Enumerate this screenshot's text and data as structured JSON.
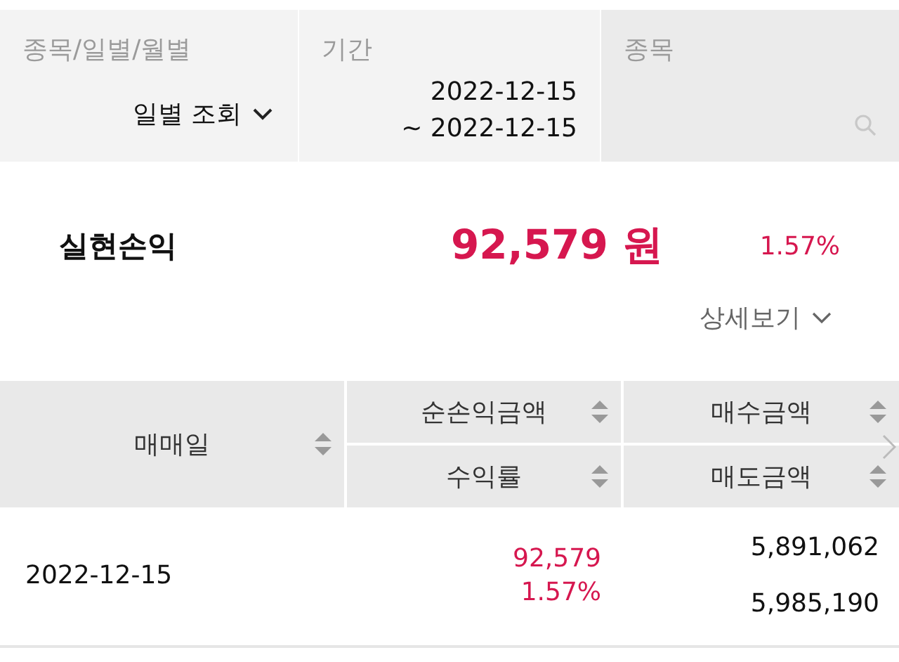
{
  "filters": [
    {
      "kind": "dropdown",
      "label": "종목/일별/월별",
      "value": "일별 조회"
    },
    {
      "kind": "range",
      "label": "기간",
      "lines": [
        "2022-12-15",
        "~ 2022-12-15"
      ]
    },
    {
      "kind": "search",
      "label": "종목"
    }
  ],
  "summary": {
    "label": "실현손익",
    "amount": "92,579 원",
    "rate": "1.57%",
    "detail_link": "상세보기"
  },
  "table": {
    "columns": [
      {
        "headers": [
          "매매일"
        ]
      },
      {
        "headers": [
          "순손익금액",
          "수익률"
        ]
      },
      {
        "headers": [
          "매수금액",
          "매도금액"
        ]
      }
    ],
    "rows": [
      {
        "cells": [
          [
            "2022-12-15"
          ],
          [
            "92,579",
            "1.57%"
          ],
          [
            "5,891,062",
            "5,985,190"
          ]
        ],
        "profit": true
      }
    ]
  }
}
